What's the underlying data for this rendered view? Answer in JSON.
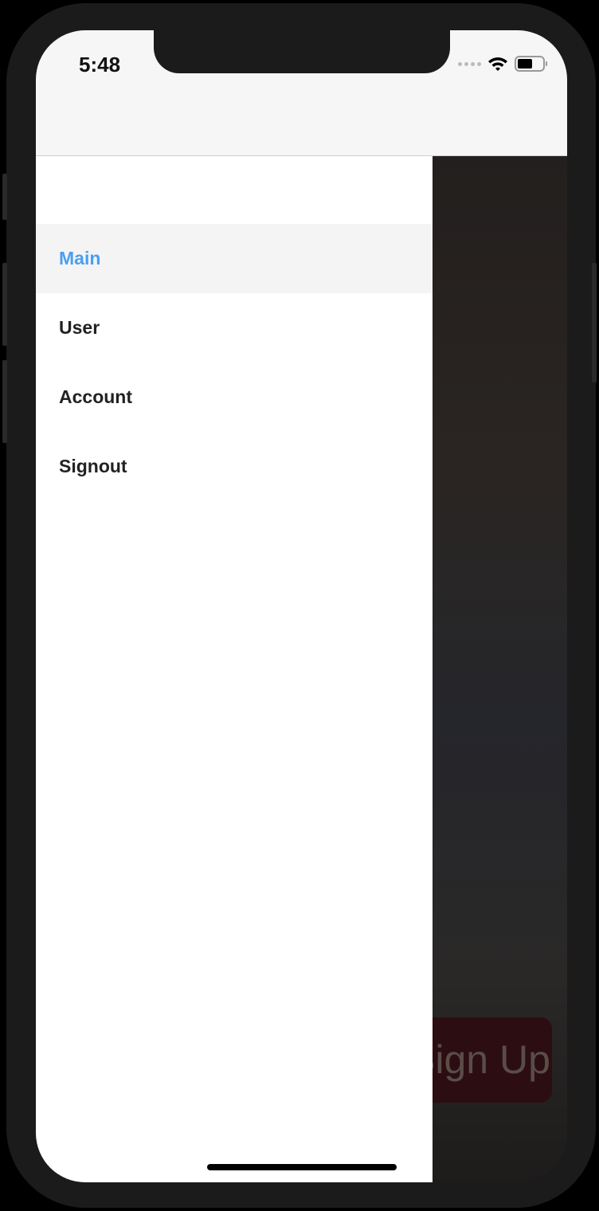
{
  "status_bar": {
    "time": "5:48"
  },
  "drawer": {
    "items": [
      {
        "label": "Main",
        "active": true
      },
      {
        "label": "User"
      },
      {
        "label": "Account"
      },
      {
        "label": "Signout"
      }
    ]
  },
  "background": {
    "signup_label": "Sign Up"
  },
  "colors": {
    "active": "#4a9ff0",
    "signup_bg": "#2c0e12"
  }
}
